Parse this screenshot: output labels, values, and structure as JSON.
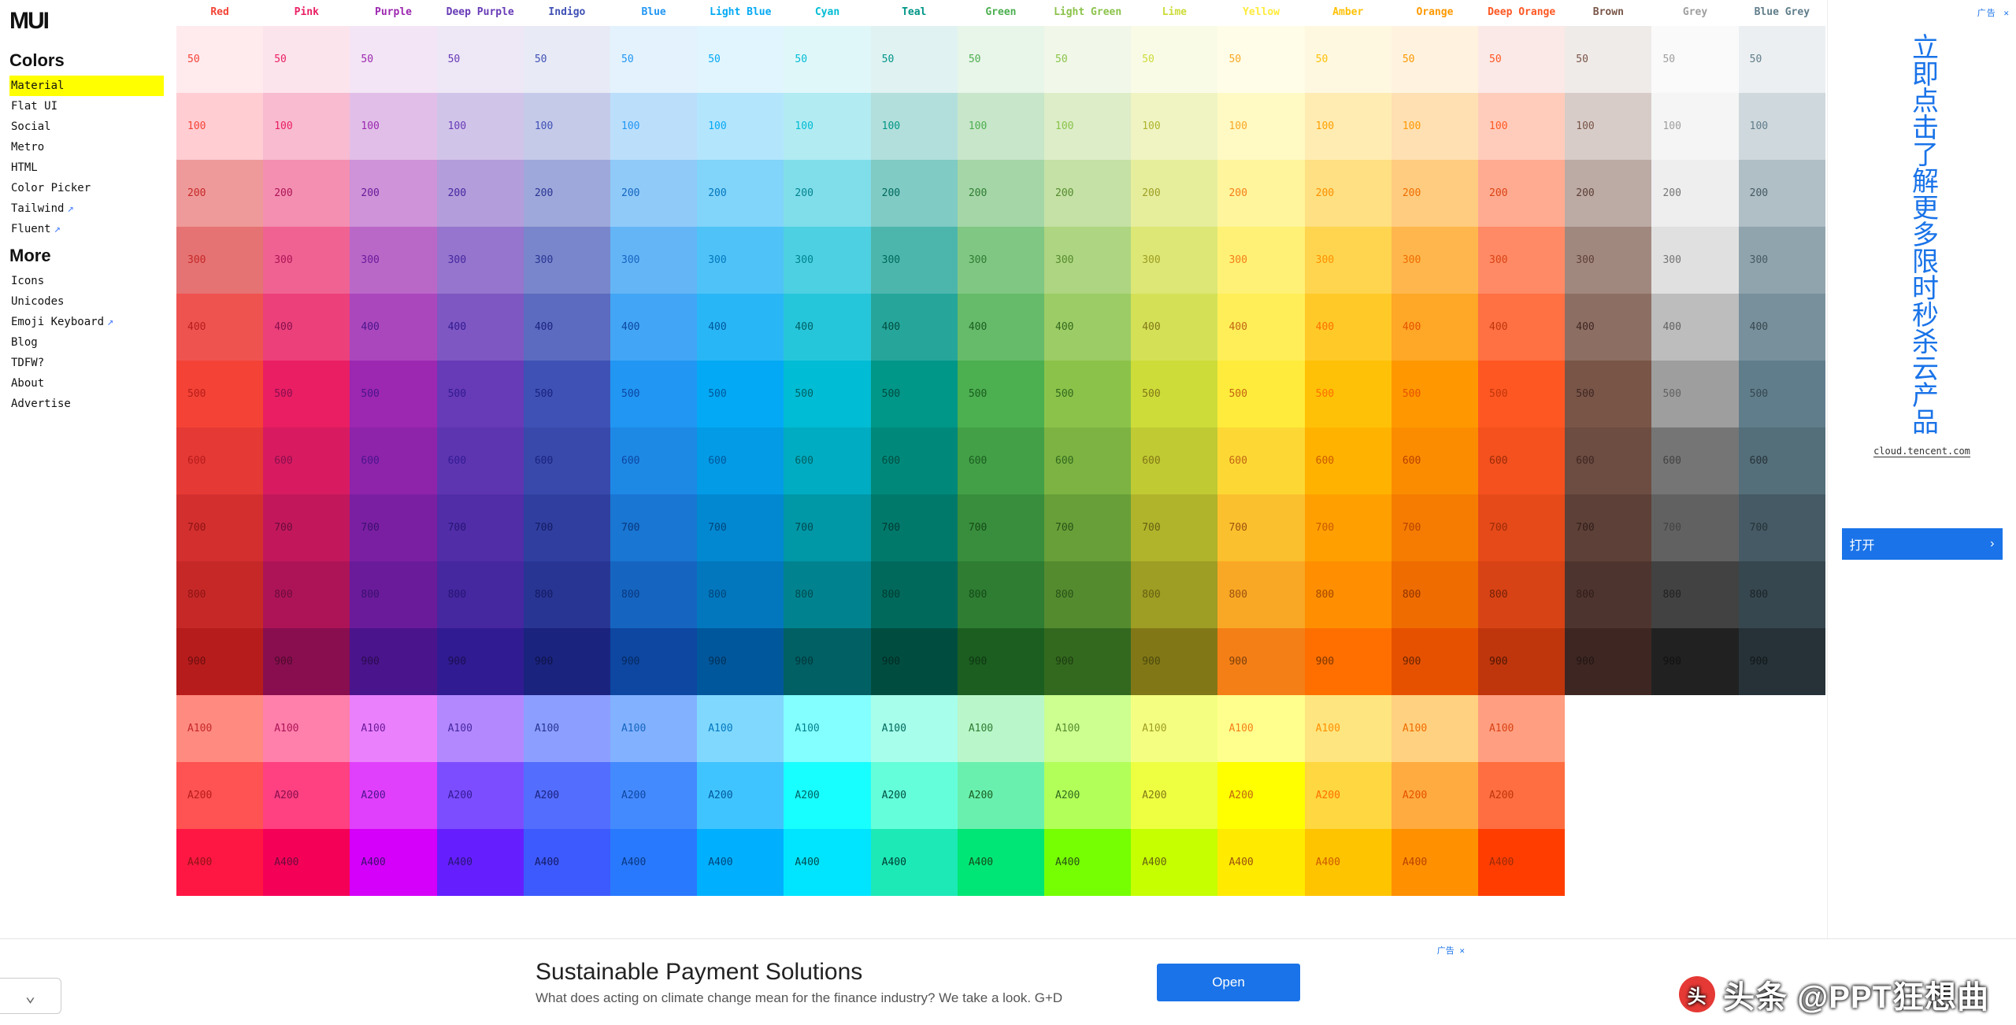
{
  "logo": "MUI",
  "sections": [
    {
      "title": "Colors",
      "items": [
        {
          "label": "Material",
          "active": true,
          "ext": false
        },
        {
          "label": "Flat UI",
          "active": false,
          "ext": false
        },
        {
          "label": "Social",
          "active": false,
          "ext": false
        },
        {
          "label": "Metro",
          "active": false,
          "ext": false
        },
        {
          "label": "HTML",
          "active": false,
          "ext": false
        },
        {
          "label": "Color Picker",
          "active": false,
          "ext": false
        },
        {
          "label": "Tailwind",
          "active": false,
          "ext": true
        },
        {
          "label": "Fluent",
          "active": false,
          "ext": true
        }
      ]
    },
    {
      "title": "More",
      "items": [
        {
          "label": "Icons",
          "active": false,
          "ext": false
        },
        {
          "label": "Unicodes",
          "active": false,
          "ext": false
        },
        {
          "label": "Emoji Keyboard",
          "active": false,
          "ext": true
        },
        {
          "label": "Blog",
          "active": false,
          "ext": false
        },
        {
          "label": "TDFW?",
          "active": false,
          "ext": false
        },
        {
          "label": "About",
          "active": false,
          "ext": false
        },
        {
          "label": "Advertise",
          "active": false,
          "ext": false
        }
      ]
    }
  ],
  "shades": [
    "50",
    "100",
    "200",
    "300",
    "400",
    "500",
    "600",
    "700",
    "800",
    "900",
    "A100",
    "A200",
    "A400"
  ],
  "hues": [
    {
      "name": "Red",
      "header": "#F44336",
      "colors": [
        "#FFEBEE",
        "#FFCDD2",
        "#EF9A9A",
        "#E57373",
        "#EF5350",
        "#F44336",
        "#E53935",
        "#D32F2F",
        "#C62828",
        "#B71C1C",
        "#FF8A80",
        "#FF5252",
        "#FF1744"
      ],
      "txt": [
        "#F44336",
        "#F44336",
        "#C62828",
        "#C62828",
        "#B71C1C",
        "#B71C1C",
        "#B71C1C",
        "#8e1313",
        "#8e1313",
        "#6b0e0e",
        "#C62828",
        "#B71C1C",
        "#8e1313"
      ]
    },
    {
      "name": "Pink",
      "header": "#E91E63",
      "colors": [
        "#FCE4EC",
        "#F8BBD0",
        "#F48FB1",
        "#F06292",
        "#EC407A",
        "#E91E63",
        "#D81B60",
        "#C2185B",
        "#AD1457",
        "#880E4F",
        "#FF80AB",
        "#FF4081",
        "#F50057"
      ],
      "txt": [
        "#E91E63",
        "#E91E63",
        "#AD1457",
        "#AD1457",
        "#880E4F",
        "#880E4F",
        "#880E4F",
        "#6a0b3d",
        "#6a0b3d",
        "#4d0a2c",
        "#AD1457",
        "#880E4F",
        "#6a0b3d"
      ]
    },
    {
      "name": "Purple",
      "header": "#9C27B0",
      "colors": [
        "#F3E5F5",
        "#E1BEE7",
        "#CE93D8",
        "#BA68C8",
        "#AB47BC",
        "#9C27B0",
        "#8E24AA",
        "#7B1FA2",
        "#6A1B9A",
        "#4A148C",
        "#EA80FC",
        "#E040FB",
        "#D500F9"
      ],
      "txt": [
        "#9C27B0",
        "#9C27B0",
        "#6A1B9A",
        "#6A1B9A",
        "#4A148C",
        "#4A148C",
        "#4A148C",
        "#3a106e",
        "#3a106e",
        "#290b4d",
        "#6A1B9A",
        "#4A148C",
        "#3a106e"
      ]
    },
    {
      "name": "Deep Purple",
      "header": "#673AB7",
      "colors": [
        "#EDE7F6",
        "#D1C4E9",
        "#B39DDB",
        "#9575CD",
        "#7E57C2",
        "#673AB7",
        "#5E35B1",
        "#512DA8",
        "#4527A0",
        "#311B92",
        "#B388FF",
        "#7C4DFF",
        "#651FFF"
      ],
      "txt": [
        "#673AB7",
        "#673AB7",
        "#4527A0",
        "#4527A0",
        "#311B92",
        "#311B92",
        "#311B92",
        "#261573",
        "#261573",
        "#1b0f52",
        "#4527A0",
        "#311B92",
        "#261573"
      ]
    },
    {
      "name": "Indigo",
      "header": "#3F51B5",
      "colors": [
        "#E8EAF6",
        "#C5CAE9",
        "#9FA8DA",
        "#7986CB",
        "#5C6BC0",
        "#3F51B5",
        "#3949AB",
        "#303F9F",
        "#283593",
        "#1A237E",
        "#8C9EFF",
        "#536DFE",
        "#3D5AFE"
      ],
      "txt": [
        "#3F51B5",
        "#3F51B5",
        "#283593",
        "#283593",
        "#1A237E",
        "#1A237E",
        "#1A237E",
        "#141b63",
        "#141b63",
        "#0e1347",
        "#283593",
        "#1A237E",
        "#141b63"
      ]
    },
    {
      "name": "Blue",
      "header": "#2196F3",
      "colors": [
        "#E3F2FD",
        "#BBDEFB",
        "#90CAF9",
        "#64B5F6",
        "#42A5F5",
        "#2196F3",
        "#1E88E5",
        "#1976D2",
        "#1565C0",
        "#0D47A1",
        "#82B1FF",
        "#448AFF",
        "#2979FF"
      ],
      "txt": [
        "#2196F3",
        "#2196F3",
        "#1565C0",
        "#1565C0",
        "#0D47A1",
        "#0D47A1",
        "#0D47A1",
        "#0a387f",
        "#0a387f",
        "#07285d",
        "#1565C0",
        "#0D47A1",
        "#0a387f"
      ]
    },
    {
      "name": "Light Blue",
      "header": "#03A9F4",
      "colors": [
        "#E1F5FE",
        "#B3E5FC",
        "#81D4FA",
        "#4FC3F7",
        "#29B6F6",
        "#03A9F4",
        "#039BE5",
        "#0288D1",
        "#0277BD",
        "#01579B",
        "#80D8FF",
        "#40C4FF",
        "#00B0FF"
      ],
      "txt": [
        "#03A9F4",
        "#03A9F4",
        "#0277BD",
        "#0277BD",
        "#01579B",
        "#01579B",
        "#01579B",
        "#01447a",
        "#01447a",
        "#013159",
        "#0277BD",
        "#01579B",
        "#01447a"
      ]
    },
    {
      "name": "Cyan",
      "header": "#00BCD4",
      "colors": [
        "#E0F7FA",
        "#B2EBF2",
        "#80DEEA",
        "#4DD0E1",
        "#26C6DA",
        "#00BCD4",
        "#00ACC1",
        "#0097A7",
        "#00838F",
        "#006064",
        "#84FFFF",
        "#18FFFF",
        "#00E5FF"
      ],
      "txt": [
        "#00BCD4",
        "#00BCD4",
        "#00838F",
        "#00838F",
        "#006064",
        "#006064",
        "#006064",
        "#004b4f",
        "#004b4f",
        "#003639",
        "#00838F",
        "#006064",
        "#004b4f"
      ]
    },
    {
      "name": "Teal",
      "header": "#009688",
      "colors": [
        "#E0F2F1",
        "#B2DFDB",
        "#80CBC4",
        "#4DB6AC",
        "#26A69A",
        "#009688",
        "#00897B",
        "#00796B",
        "#00695C",
        "#004D40",
        "#A7FFEB",
        "#64FFDA",
        "#1DE9B6"
      ],
      "txt": [
        "#009688",
        "#009688",
        "#00695C",
        "#00695C",
        "#004D40",
        "#004D40",
        "#004D40",
        "#003b31",
        "#003b31",
        "#002a23",
        "#00695C",
        "#004D40",
        "#003b31"
      ]
    },
    {
      "name": "Green",
      "header": "#4CAF50",
      "colors": [
        "#E8F5E9",
        "#C8E6C9",
        "#A5D6A7",
        "#81C784",
        "#66BB6A",
        "#4CAF50",
        "#43A047",
        "#388E3C",
        "#2E7D32",
        "#1B5E20",
        "#B9F6CA",
        "#69F0AE",
        "#00E676"
      ],
      "txt": [
        "#4CAF50",
        "#4CAF50",
        "#2E7D32",
        "#2E7D32",
        "#1B5E20",
        "#1B5E20",
        "#1B5E20",
        "#154a19",
        "#154a19",
        "#0f3612",
        "#2E7D32",
        "#1B5E20",
        "#154a19"
      ]
    },
    {
      "name": "Light Green",
      "header": "#8BC34A",
      "colors": [
        "#F1F8E9",
        "#DCEDC8",
        "#C5E1A5",
        "#AED581",
        "#9CCC65",
        "#8BC34A",
        "#7CB342",
        "#689F38",
        "#558B2F",
        "#33691E",
        "#CCFF90",
        "#B2FF59",
        "#76FF03"
      ],
      "txt": [
        "#8BC34A",
        "#8BC34A",
        "#558B2F",
        "#558B2F",
        "#33691E",
        "#33691E",
        "#33691E",
        "#275217",
        "#275217",
        "#1c3b11",
        "#558B2F",
        "#33691E",
        "#275217"
      ]
    },
    {
      "name": "Lime",
      "header": "#CDDC39",
      "colors": [
        "#F9FBE7",
        "#F0F4C3",
        "#E6EE9C",
        "#DCE775",
        "#D4E157",
        "#CDDC39",
        "#C0CA33",
        "#AFB42B",
        "#9E9D24",
        "#827717",
        "#F4FF81",
        "#EEFF41",
        "#C6FF00"
      ],
      "txt": [
        "#CDDC39",
        "#AFB42B",
        "#9E9D24",
        "#9E9D24",
        "#827717",
        "#827717",
        "#827717",
        "#666011",
        "#666011",
        "#4a4a0c",
        "#9E9D24",
        "#827717",
        "#666011"
      ]
    },
    {
      "name": "Yellow",
      "header": "#FFEB3B",
      "colors": [
        "#FFFDE7",
        "#FFF9C4",
        "#FFF59D",
        "#FFF176",
        "#FFEE58",
        "#FFEB3B",
        "#FDD835",
        "#FBC02D",
        "#F9A825",
        "#F57F17",
        "#FFFF8D",
        "#FFFF00",
        "#FFEA00"
      ],
      "txt": [
        "#F9A825",
        "#F9A825",
        "#F57F17",
        "#F57F17",
        "#c26512",
        "#c26512",
        "#c26512",
        "#9c510e",
        "#9c510e",
        "#7a400b",
        "#F57F17",
        "#c26512",
        "#9c510e"
      ]
    },
    {
      "name": "Amber",
      "header": "#FFC107",
      "colors": [
        "#FFF8E1",
        "#FFECB3",
        "#FFE082",
        "#FFD54F",
        "#FFCA28",
        "#FFC107",
        "#FFB300",
        "#FFA000",
        "#FF8F00",
        "#FF6F00",
        "#FFE57F",
        "#FFD740",
        "#FFC400"
      ],
      "txt": [
        "#FFC107",
        "#FFA000",
        "#FF8F00",
        "#FF8F00",
        "#FF6F00",
        "#FF6F00",
        "#cc5900",
        "#cc5900",
        "#a34800",
        "#7a3600",
        "#FF8F00",
        "#FF6F00",
        "#cc5900"
      ]
    },
    {
      "name": "Orange",
      "header": "#FF9800",
      "colors": [
        "#FFF3E0",
        "#FFE0B2",
        "#FFCC80",
        "#FFB74D",
        "#FFA726",
        "#FF9800",
        "#FB8C00",
        "#F57C00",
        "#EF6C00",
        "#E65100",
        "#FFD180",
        "#FFAB40",
        "#FF9100"
      ],
      "txt": [
        "#FF9800",
        "#FF9800",
        "#EF6C00",
        "#EF6C00",
        "#E65100",
        "#E65100",
        "#b84100",
        "#b84100",
        "#8f3300",
        "#662400",
        "#EF6C00",
        "#E65100",
        "#b84100"
      ]
    },
    {
      "name": "Deep Orange",
      "header": "#FF5722",
      "colors": [
        "#FBE9E7",
        "#FFCCBC",
        "#FFAB91",
        "#FF8A65",
        "#FF7043",
        "#FF5722",
        "#F4511E",
        "#E64A19",
        "#D84315",
        "#BF360C",
        "#FF9E80",
        "#FF6E40",
        "#FF3D00"
      ],
      "txt": [
        "#FF5722",
        "#FF5722",
        "#D84315",
        "#D84315",
        "#BF360C",
        "#BF360C",
        "#992b09",
        "#992b09",
        "#732007",
        "#4d1604",
        "#D84315",
        "#BF360C",
        "#992b09"
      ]
    },
    {
      "name": "Brown",
      "header": "#795548",
      "colors": [
        "#EFEBE9",
        "#D7CCC8",
        "#BCAAA4",
        "#A1887F",
        "#8D6E63",
        "#795548",
        "#6D4C41",
        "#5D4037",
        "#4E342E",
        "#3E2723"
      ],
      "txt": [
        "#795548",
        "#795548",
        "#5D4037",
        "#5D4037",
        "#3E2723",
        "#3E2723",
        "#3E2723",
        "#2f1d1a",
        "#2f1d1a",
        "#211413"
      ]
    },
    {
      "name": "Grey",
      "header": "#9E9E9E",
      "colors": [
        "#FAFAFA",
        "#F5F5F5",
        "#EEEEEE",
        "#E0E0E0",
        "#BDBDBD",
        "#9E9E9E",
        "#757575",
        "#616161",
        "#424242",
        "#212121"
      ],
      "txt": [
        "#9E9E9E",
        "#9E9E9E",
        "#757575",
        "#757575",
        "#616161",
        "#616161",
        "#424242",
        "#424242",
        "#212121",
        "#111111"
      ]
    },
    {
      "name": "Blue Grey",
      "header": "#607D8B",
      "colors": [
        "#ECEFF1",
        "#CFD8DC",
        "#B0BEC5",
        "#90A4AE",
        "#78909C",
        "#607D8B",
        "#546E7A",
        "#455A64",
        "#37474F",
        "#263238"
      ],
      "txt": [
        "#607D8B",
        "#607D8B",
        "#455A64",
        "#455A64",
        "#37474F",
        "#37474F",
        "#263238",
        "#263238",
        "#1b2327",
        "#111719"
      ]
    }
  ],
  "rightAd": {
    "marker": "广告",
    "close": "✕",
    "text": "立即点击了解更多限时秒杀云产品",
    "link": "cloud.tencent.com",
    "open": "打开",
    "chev": "›"
  },
  "bottomAd": {
    "headline": "Sustainable Payment Solutions",
    "sub": "What does acting on climate change mean for the finance industry? We take a look. G+D",
    "btn": "Open",
    "marker": "广告 ✕",
    "chev": "⌄"
  },
  "watermark": {
    "icon": "头",
    "text": "头条 @PPT狂想曲"
  }
}
